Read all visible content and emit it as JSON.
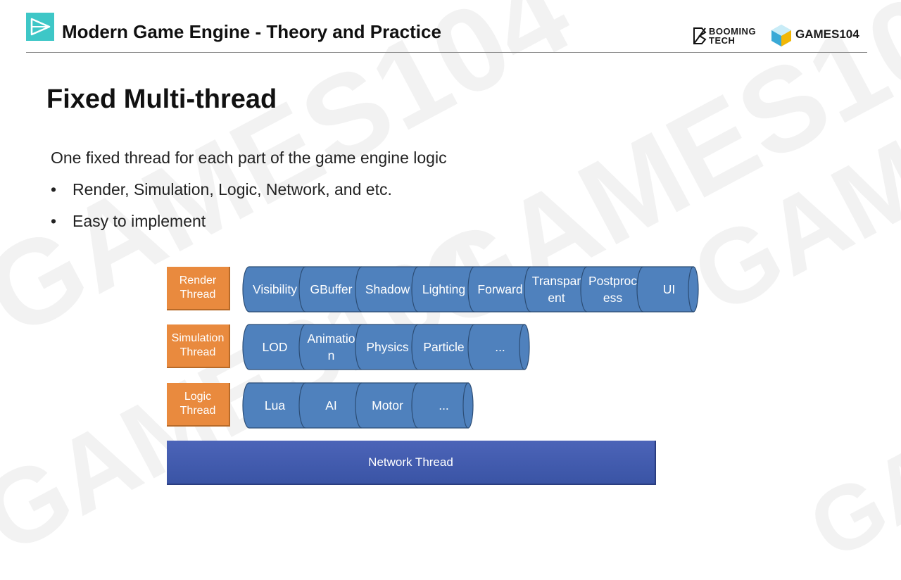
{
  "header": {
    "title": "Modern Game Engine - Theory and Practice",
    "brand_booming_line1": "BOOMING",
    "brand_booming_line2": "TECH",
    "brand_games": "GAMES104"
  },
  "slide": {
    "title": "Fixed Multi-thread",
    "intro": "One fixed thread for each part of the game engine logic",
    "bullets": [
      "Render, Simulation, Logic, Network, and etc.",
      "Easy to implement"
    ]
  },
  "watermark": {
    "text": "GAMES104",
    "brand_line1": "BOOMING",
    "brand_line2": "TECH"
  },
  "diagram": {
    "rows": [
      {
        "name": "render",
        "label": [
          "Render",
          "Thread"
        ],
        "segments": [
          [
            "Visibility"
          ],
          [
            "GBuffer"
          ],
          [
            "Shadow"
          ],
          [
            "Lighting"
          ],
          [
            "Forward"
          ],
          [
            "Transpar",
            "ent"
          ],
          [
            "Postproc",
            "ess"
          ],
          [
            "UI"
          ]
        ]
      },
      {
        "name": "simulation",
        "label": [
          "Simulation",
          "Thread"
        ],
        "segments": [
          [
            "LOD"
          ],
          [
            "Animatio",
            "n"
          ],
          [
            "Physics"
          ],
          [
            "Particle"
          ],
          [
            "..."
          ]
        ]
      },
      {
        "name": "logic",
        "label": [
          "Logic",
          "Thread"
        ],
        "segments": [
          [
            "Lua"
          ],
          [
            "AI"
          ],
          [
            "Motor"
          ],
          [
            "..."
          ]
        ]
      }
    ],
    "network_label": "Network Thread",
    "colors": {
      "thread_label": "#e98a3e",
      "segment_fill": "#4f81bd",
      "segment_stroke": "#2c4d75",
      "network": "#3f57a8"
    }
  }
}
